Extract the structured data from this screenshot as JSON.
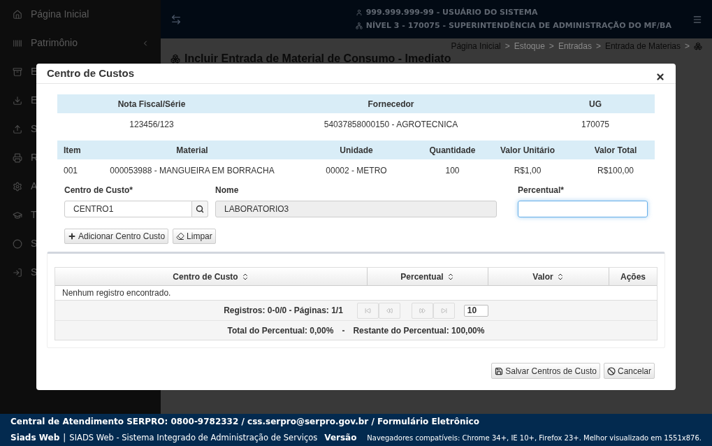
{
  "sidebar": {
    "items": [
      {
        "label": "Página Inicial"
      },
      {
        "label": "Patrimônio",
        "expandable": true
      },
      {
        "label": "E"
      },
      {
        "label": "E"
      },
      {
        "label": "S"
      },
      {
        "label": "R"
      },
      {
        "label": "A"
      },
      {
        "label": "T"
      },
      {
        "label": "S"
      },
      {
        "label": "S"
      }
    ]
  },
  "header": {
    "user": "999.999.999-99 - USUÁRIO DO SISTEMA",
    "level": "NÍVEL 3 - 170075 - SUPERINTENDÊNCIA DE ADMINISTRAÇÃO DO MF/BA"
  },
  "breadcrumb": [
    {
      "label": "Página Inicial",
      "disabled": false,
      "separator": ">"
    },
    {
      "label": "Estoque",
      "disabled": true,
      "separator": ">"
    },
    {
      "label": "Entradas",
      "disabled": true,
      "separator": ">"
    },
    {
      "label": "Entrada de Materias",
      "disabled": false,
      "separator": ">"
    }
  ],
  "page_title": "Incluir Entrada de Material de Consumo - Imediato",
  "modal": {
    "title": "Centro de Custos",
    "invoice": {
      "columns": [
        "Nota Fiscal/Série",
        "Fornecedor",
        "UG"
      ],
      "row": [
        "123456/123",
        "54037858000150 - AGROTECNICA",
        "170075"
      ]
    },
    "items": {
      "columns": [
        "Item",
        "Material",
        "Unidade",
        "Quantidade",
        "Valor Unitário",
        "Valor Total"
      ],
      "row": [
        "001",
        "000053988 - MANGUEIRA EM BORRACHA",
        "00002 - METRO",
        "100",
        "R$1,00",
        "R$100,00"
      ]
    },
    "form": {
      "cost_center": {
        "label": "Centro de Custo*",
        "value": "CENTRO1"
      },
      "name": {
        "label": "Nome",
        "value": "LABORATORIO3",
        "disabled": true
      },
      "percent": {
        "label": "Percentual*",
        "focused": true
      }
    },
    "form_buttons": [
      "Adicionar Centro Custo",
      "Limpar"
    ],
    "grid": {
      "columns": [
        {
          "label": "Centro de Custo",
          "sortable": true
        },
        {
          "label": "Percentual",
          "sortable": true
        },
        {
          "label": "Valor",
          "sortable": true
        },
        {
          "label": "Ações",
          "sortable": false
        }
      ],
      "empty_message": "Nenhum registro encontrado.",
      "paginator": {
        "summary": "Registros: 0-0/0 - Páginas: 1/1",
        "page_size": "10"
      },
      "totals": {
        "total": "Total do Percentual: 0,00%",
        "separator": "-",
        "remaining": "Restante do Percentual: 100,00%"
      }
    },
    "footer_buttons": [
      "Salvar Centros de Custo",
      "Cancelar"
    ]
  },
  "footer": {
    "contact": "Central de Atendimento SERPRO: 0800-9782332 / css.serpro@serpro.gov.br / Formulário Eletrônico",
    "app": "Siads Web",
    "separator": "|",
    "description": "SIADS Web - Sistema Integrado de Administração de Serviços",
    "version": "Versão",
    "browsers": "Navegadores compatíveis: Chrome 34+, IE 10+, Firefox 23+. Melhor visualizado em 1551x876."
  }
}
